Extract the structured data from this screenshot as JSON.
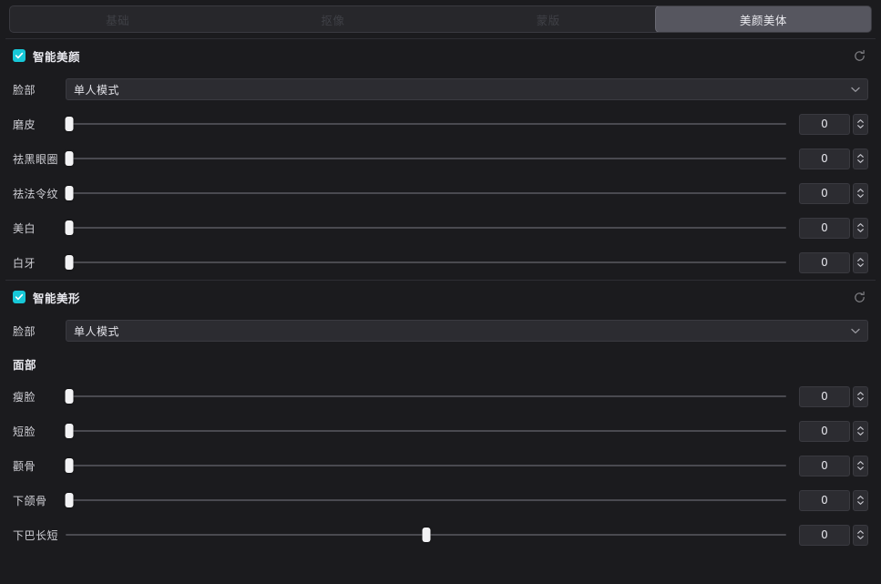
{
  "tabs": [
    {
      "label": "基础",
      "active": false
    },
    {
      "label": "抠像",
      "active": false
    },
    {
      "label": "蒙版",
      "active": false
    },
    {
      "label": "美颜美体",
      "active": true
    }
  ],
  "beauty_section": {
    "title": "智能美颜",
    "checked": true,
    "reset_icon": "reset-icon",
    "face_row": {
      "label": "脸部",
      "value": "单人模式"
    },
    "sliders": [
      {
        "label": "磨皮",
        "value": "0",
        "pos": 0
      },
      {
        "label": "祛黑眼圈",
        "value": "0",
        "pos": 0
      },
      {
        "label": "祛法令纹",
        "value": "0",
        "pos": 0
      },
      {
        "label": "美白",
        "value": "0",
        "pos": 0
      },
      {
        "label": "白牙",
        "value": "0",
        "pos": 0
      }
    ]
  },
  "reshape_section": {
    "title": "智能美形",
    "checked": true,
    "reset_icon": "reset-icon",
    "face_row": {
      "label": "脸部",
      "value": "单人模式"
    },
    "subhead": "面部",
    "sliders": [
      {
        "label": "瘦脸",
        "value": "0",
        "pos": 0
      },
      {
        "label": "短脸",
        "value": "0",
        "pos": 0
      },
      {
        "label": "颧骨",
        "value": "0",
        "pos": 0
      },
      {
        "label": "下颌骨",
        "value": "0",
        "pos": 0
      },
      {
        "label": "下巴长短",
        "value": "0",
        "pos": 50
      }
    ]
  },
  "colors": {
    "background": "#1b1b1e",
    "accent": "#17c8d8",
    "active_tab": "#56565f",
    "field": "#2c2c31",
    "border": "#3a3a40",
    "handle": "#f2f2f4"
  }
}
